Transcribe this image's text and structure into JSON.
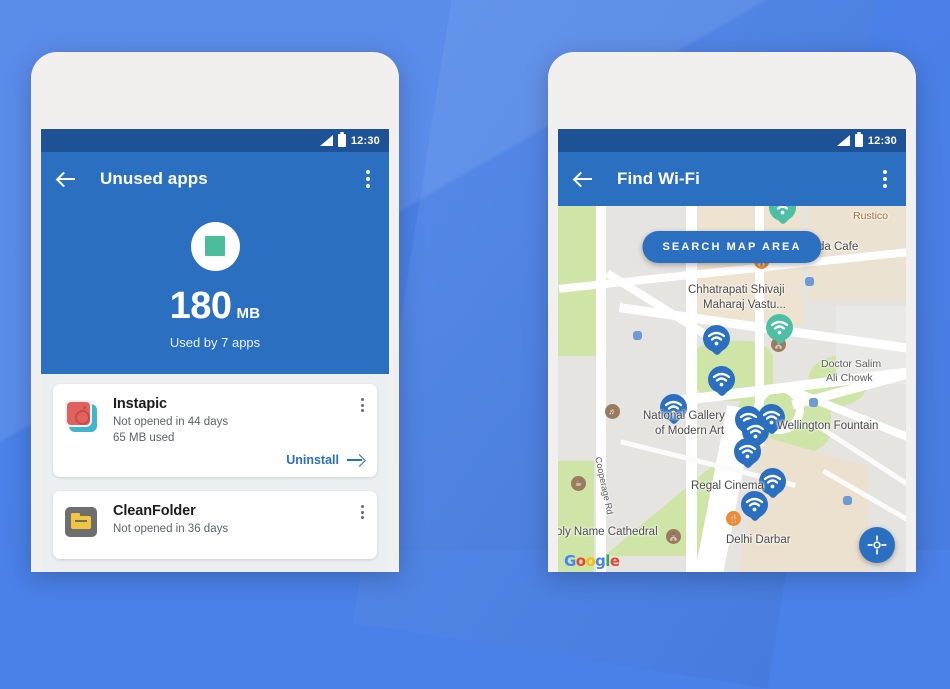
{
  "background": {
    "color": "#4a81e8"
  },
  "phones": {
    "left": {
      "status_bar": {
        "time": "12:30",
        "signal_icon": "signal-icon",
        "battery_icon": "battery-icon"
      },
      "toolbar": {
        "back_icon": "back-arrow-icon",
        "title": "Unused apps",
        "overflow_icon": "overflow-menu-icon"
      },
      "hero": {
        "icon": "duplicate-squares-icon",
        "value": "180",
        "unit": "MB",
        "subtitle": "Used by 7 apps"
      },
      "apps": [
        {
          "icon": "instapic-app-icon",
          "name": "Instapic",
          "last_opened": "Not opened in 44 days",
          "size_used": "65 MB used",
          "action_label": "Uninstall",
          "action_icon": "arrow-right-icon",
          "overflow_icon": "overflow-menu-icon"
        },
        {
          "icon": "cleanfolder-app-icon",
          "name": "CleanFolder",
          "last_opened": "Not opened in 36 days",
          "size_used": "",
          "action_label": "",
          "action_icon": "",
          "overflow_icon": "overflow-menu-icon"
        }
      ]
    },
    "right": {
      "status_bar": {
        "time": "12:30",
        "signal_icon": "signal-icon",
        "battery_icon": "battery-icon"
      },
      "toolbar": {
        "back_icon": "back-arrow-icon",
        "title": "Find Wi-Fi",
        "overflow_icon": "overflow-menu-icon"
      },
      "map": {
        "search_button": "SEARCH MAP AREA",
        "my_location_icon": "my-location-icon",
        "attribution": "Google",
        "labels": [
          {
            "text": "Rustico",
            "kind": "business"
          },
          {
            "text": "da Cafe",
            "kind": "business"
          },
          {
            "text": "Chhatrapati Shivaji",
            "kind": "place"
          },
          {
            "text": "Maharaj Vastu...",
            "kind": "place"
          },
          {
            "text": "Doctor Salim",
            "kind": "place"
          },
          {
            "text": "Ali Chowk",
            "kind": "place"
          },
          {
            "text": "National Gallery",
            "kind": "place"
          },
          {
            "text": "of Modern Art",
            "kind": "place"
          },
          {
            "text": "Wellington Fountain",
            "kind": "place"
          },
          {
            "text": "Regal Cinema",
            "kind": "cinema"
          },
          {
            "text": "Delhi Darbar",
            "kind": "business"
          },
          {
            "text": "oly Name Cathedral",
            "kind": "place"
          },
          {
            "text": "Cooperage Rd",
            "kind": "street"
          }
        ],
        "wifi_pin_count": 11
      }
    }
  },
  "colors": {
    "brand_blue": "#2a6fc0",
    "status_bar_blue": "#1d5296",
    "background_blue": "#4a81e8",
    "list_bg": "#eceff1",
    "accent_green": "#4bbd9a"
  }
}
